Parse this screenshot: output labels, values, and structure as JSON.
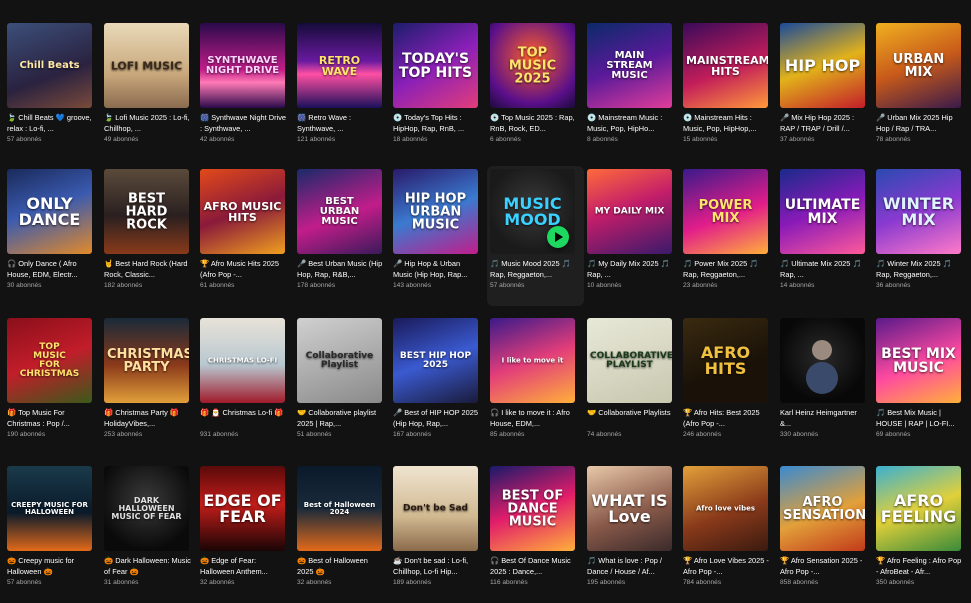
{
  "playlists": [
    {
      "title": "🍃 Chill Beats 💙 groove, relax : Lo-fi, ...",
      "subs": "57 abonnés",
      "cover": "Chill Beats",
      "bg": "linear-gradient(160deg,#3c4f7a,#2a2240 60%,#7a4a3a)",
      "fg": "#ffe7a8"
    },
    {
      "title": "🍃 Lofi Music 2025 : Lo-fi, Chillhop, ...",
      "subs": "49 abonnés",
      "cover": "LOFI MUSIC",
      "bg": "linear-gradient(180deg,#e8d9b8,#c9a87c 60%,#8a6b4f)",
      "fg": "#3a2a1a"
    },
    {
      "title": "🎆 Synthwave Night Drive : Synthwave, ...",
      "subs": "42 abonnés",
      "cover": "SYNTHWAVE\nNIGHT DRIVE",
      "bg": "linear-gradient(180deg,#2a0a4a,#c21d8a 55%,#ff7ab6 70%,#2a0a4a)",
      "fg": "#ffd3ff"
    },
    {
      "title": "🎆 Retro Wave : Synthwave, ...",
      "subs": "121 abonnés",
      "cover": "RETRO WAVE",
      "bg": "linear-gradient(180deg,#150c3a,#6a1aa0 45%,#ff4fa3 60%,#1a0f5a)",
      "fg": "#ffe26b"
    },
    {
      "title": "💿 Today's Top Hits : HipHop, Rap, RnB, ...",
      "subs": "18 abonnés",
      "cover": "TODAY'S\nTOP HITS",
      "bg": "linear-gradient(150deg,#1b1e6b,#8a1fb8 50%,#e23d7a)",
      "fg": "#ffffff"
    },
    {
      "title": "💿 Top Music 2025 : Rap, RnB, Rock, ED...",
      "subs": "6 abonnés",
      "cover": "TOP\nMUSIC\n2025",
      "bg": "radial-gradient(circle at 50% 40%,#ff5e2a,#5a0f8a 70%,#1b0b3a)",
      "fg": "#ffe36a"
    },
    {
      "title": "💿 Mainstream Music : Music, Pop, HipHo...",
      "subs": "8 abonnés",
      "cover": "MAIN STREAM\nMUSIC",
      "bg": "linear-gradient(160deg,#0b2a6a,#5a1a9a 50%,#e23d9a)",
      "fg": "#ffffff"
    },
    {
      "title": "💿 Mainstream Hits : Music, Pop, HipHop,...",
      "subs": "15 abonnés",
      "cover": "MAINSTREAM\nHITS",
      "bg": "linear-gradient(160deg,#3a0a5a,#c21d5a 55%,#ff9a3a)",
      "fg": "#ffffff"
    },
    {
      "title": "🎤 Mix Hip Hop 2025 : RAP / TRAP / Drill /...",
      "subs": "37 abonnés",
      "cover": "HIP HOP",
      "bg": "linear-gradient(160deg,#1a4a9a,#e2b21a 50%,#c21d2a)",
      "fg": "#ffffff"
    },
    {
      "title": "🎤 Urban Mix 2025 Hip Hop / Rap / TRA...",
      "subs": "78 abonnés",
      "cover": "URBAN MIX",
      "bg": "linear-gradient(160deg,#f0b020,#c85a1a 50%,#3a1a4a)",
      "fg": "#ffffff"
    },
    {
      "title": "🎧 Only Dance ( Afro House, EDM, Electr...",
      "subs": "30 abonnés",
      "cover": "ONLY\nDANCE",
      "bg": "linear-gradient(160deg,#1a2a5a,#3a5ab0 45%,#e28a2a)",
      "fg": "#ffffff"
    },
    {
      "title": "🤘 Best Hard Rock (Hard Rock, Classic...",
      "subs": "182 abonnés",
      "cover": "BEST\nHARD ROCK",
      "bg": "linear-gradient(180deg,#5a4a3a,#2a2020 55%,#8a3a1a)",
      "fg": "#ffffff"
    },
    {
      "title": "🏆 Afro Music Hits 2025 (Afro Pop -...",
      "subs": "61 abonnés",
      "cover": "AFRO MUSIC\nHITS",
      "bg": "linear-gradient(160deg,#e24a1a,#8a1a3a 50%,#f0a020)",
      "fg": "#ffffff"
    },
    {
      "title": "🎤 Best Urban Music (Hip Hop, Rap, R&B,...",
      "subs": "178 abonnés",
      "cover": "BEST\nURBAN MUSIC",
      "bg": "linear-gradient(160deg,#1a2a6a,#c21d8a 55%,#3a1a5a)",
      "fg": "#ffffff"
    },
    {
      "title": "🎤 Hip Hop & Urban Music (Hip Hop, Rap...",
      "subs": "143 abonnés",
      "cover": "HIP HOP\nURBAN\nMUSIC",
      "bg": "linear-gradient(160deg,#2a1a6a,#3a7ad0 50%,#c21d8a)",
      "fg": "#ffffff"
    },
    {
      "title": "🎵 Music Mood 2025 🎵 Rap, Reggaeton,...",
      "subs": "57 abonnés",
      "cover": "MUSIC\nMOOD",
      "bg": "radial-gradient(circle at 50% 45%,#3a3a3a,#1a1a1a 70%)",
      "fg": "#3ad0ff"
    },
    {
      "title": "🎵 My Daily Mix 2025 🎵 Rap, ...",
      "subs": "10 abonnés",
      "cover": "MY DAILY MIX",
      "bg": "linear-gradient(160deg,#ff6a3a,#c21d6a 45%,#3a1a6a)",
      "fg": "#ffffff"
    },
    {
      "title": "🎵 Power Mix 2025 🎵 Rap, Reggaeton,...",
      "subs": "23 abonnés",
      "cover": "POWER MIX",
      "bg": "linear-gradient(160deg,#3a1a8a,#e21d8a 55%,#ffb03a)",
      "fg": "#ffe36a"
    },
    {
      "title": "🎵 Ultimate Mix 2025 🎵 Rap, ...",
      "subs": "14 abonnés",
      "cover": "ULTIMATE\nMIX",
      "bg": "linear-gradient(160deg,#1a2a8a,#8a1ab8 50%,#ff5a9a)",
      "fg": "#ffffff"
    },
    {
      "title": "🎵 Winter Mix 2025 🎵 Rap, Reggaeton,...",
      "subs": "36 abonnés",
      "cover": "WINTER\nMIX",
      "bg": "linear-gradient(160deg,#2a4ab0,#8a3ad0 50%,#ff7ac8)",
      "fg": "#e0f4ff"
    },
    {
      "title": "🎁 Top Music For Christmas : Pop /...",
      "subs": "190 abonnés",
      "cover": "TOP\nMUSIC\nFOR CHRISTMAS",
      "bg": "linear-gradient(160deg,#8a0f1a,#c21d2a 50%,#3a5a1a)",
      "fg": "#ffe36a"
    },
    {
      "title": "🎁 Christmas Party 🎁 HolidayVibes,...",
      "subs": "253 abonnés",
      "cover": "CHRISTMAS\nPARTY",
      "bg": "linear-gradient(180deg,#1a2a3a,#8a3a1a 55%,#e2a03a)",
      "fg": "#ffe0a0"
    },
    {
      "title": "🎁 🎅 Christmas Lo-fi 🎁",
      "subs": "931 abonnés",
      "cover": "CHRISTMAS LO-FI",
      "bg": "linear-gradient(180deg,#e8e2d8,#b8c8d0 55%,#a01a2a)",
      "fg": "#ffffff"
    },
    {
      "title": "🤝 Collaborative playlist 2025 | Rap,...",
      "subs": "51 abonnés",
      "cover": "Collaborative\nPlaylist",
      "bg": "linear-gradient(160deg,#d0d0d0,#8a8a8a)",
      "fg": "#2a2a2a"
    },
    {
      "title": "🎤 Best of HIP HOP 2025 (Hip Hop, Rap,...",
      "subs": "167 abonnés",
      "cover": "BEST HIP HOP\n2025",
      "bg": "linear-gradient(160deg,#1a1a5a,#3a5ad0 50%,#1a1a3a)",
      "fg": "#ffffff"
    },
    {
      "title": "🎧 I like to move it : Afro House, EDM,...",
      "subs": "85 abonnés",
      "cover": "I like to move it",
      "bg": "linear-gradient(160deg,#3a1a8a,#e23d7a 50%,#ffb03a)",
      "fg": "#ffffff"
    },
    {
      "title": "🤝 Collaborative Playlists",
      "subs": "74 abonnés",
      "cover": "COLLABORATIVE\nPLAYLIST",
      "bg": "linear-gradient(160deg,#e8e8d8,#c8c8b0)",
      "fg": "#1a3a1a"
    },
    {
      "title": "🏆 Afro Hits: Best 2025 (Afro Pop -...",
      "subs": "246 abonnés",
      "cover": "AFRO\nHITS",
      "bg": "linear-gradient(160deg,#3a2a10,#1a1208 60%)",
      "fg": "#f0c040"
    },
    {
      "title": "Karl Heinz Heimgartner &...",
      "subs": "330 abonnés",
      "cover": "",
      "bg": "radial-gradient(circle at 50% 45%,#2a2a2a,#080808 70%)",
      "fg": "#ffffff"
    },
    {
      "title": "🎵 Best Mix Music | HOUSE | RAP | LO-FI...",
      "subs": "69 abonnés",
      "cover": "BEST MIX\nMUSIC",
      "bg": "linear-gradient(160deg,#5a1a8a,#ff4aa0 55%,#ffb03a)",
      "fg": "#ffffff"
    },
    {
      "title": "🎃 Creepy music for Halloween 🎃",
      "subs": "57 abonnés",
      "cover": "CREEPY MUSIC FOR\nHALLOWEEN",
      "bg": "linear-gradient(180deg,#1a3a4a,#0a1a2a 55%,#e26a1a)",
      "fg": "#ffffff"
    },
    {
      "title": "🎃 Dark Halloween: Music of Fear 🎃",
      "subs": "31 abonnés",
      "cover": "DARK HALLOWEEN\nMUSIC OF FEAR",
      "bg": "radial-gradient(circle at 50% 40%,#3a3a3a,#0a0a0a 75%)",
      "fg": "#e0e0e0"
    },
    {
      "title": "🎃 Edge of Fear: Halloween Anthem...",
      "subs": "32 abonnés",
      "cover": "EDGE OF\nFEAR",
      "bg": "linear-gradient(180deg,#5a0a0a,#c21d1a 45%,#1a0505)",
      "fg": "#ffffff"
    },
    {
      "title": "🎃 Best of Halloween 2025 🎃",
      "subs": "32 abonnés",
      "cover": "Best of Halloween\n2024",
      "bg": "linear-gradient(180deg,#0a1a2a,#1a2a3a 50%,#e26a1a)",
      "fg": "#ffffff"
    },
    {
      "title": "☕ Don't be sad : Lo-fi, Chillhop, Lo-fi Hip...",
      "subs": "189 abonnés",
      "cover": "Don't be Sad",
      "bg": "linear-gradient(180deg,#f0e4d0,#d0b890 60%,#8a6a4a)",
      "fg": "#2a1a10"
    },
    {
      "title": "🎧 Best Of Dance Music 2025 : Dance,...",
      "subs": "116 abonnés",
      "cover": "BEST OF\nDANCE\nMUSIC",
      "bg": "linear-gradient(160deg,#1a1a6a,#e21d6a 50%,#ffb03a)",
      "fg": "#ffffff"
    },
    {
      "title": "🎵 What is love : Pop / Dance / House / Af...",
      "subs": "195 abonnés",
      "cover": "WHAT IS\nLove",
      "bg": "linear-gradient(160deg,#e8c8a8,#8a5a4a 55%,#3a2a2a)",
      "fg": "#ffffff"
    },
    {
      "title": "🏆 Afro Love Vibes 2025 - Afro Pop -...",
      "subs": "784 abonnés",
      "cover": "Afro love vibes",
      "bg": "linear-gradient(160deg,#e2a03a,#8a3a1a 55%,#3a1a10)",
      "fg": "#ffffff"
    },
    {
      "title": "🏆 Afro Sensation 2025 - Afro Pop -...",
      "subs": "858 abonnés",
      "cover": "AFRO\nSENSATION",
      "bg": "linear-gradient(160deg,#3a8ad0,#e2a03a 55%,#c23a1a)",
      "fg": "#ffffff"
    },
    {
      "title": "🏆 Afro Feeling : Afro Pop - AfroBeat - Afr...",
      "subs": "350 abonnés",
      "cover": "AFRO\nFEELING",
      "bg": "linear-gradient(160deg,#3ab0d0,#e2d03a 50%,#3a8a3a)",
      "fg": "#ffffff"
    }
  ]
}
